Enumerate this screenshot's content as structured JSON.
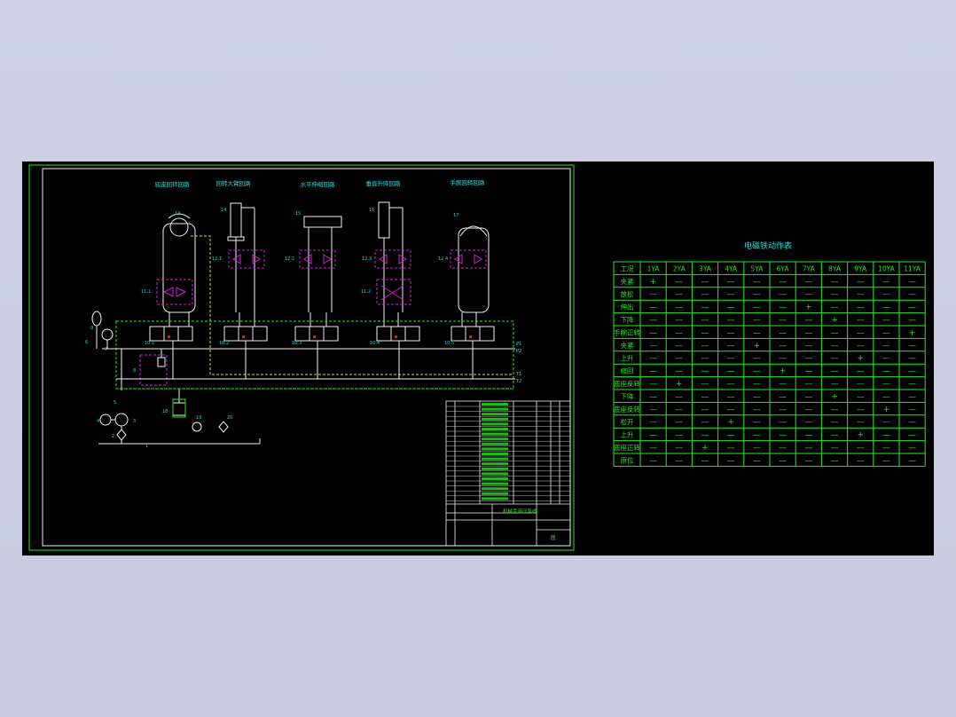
{
  "colors": {
    "background": "#000000",
    "viewport_surround": "#cfd0e6",
    "frame": "#27e81f",
    "lines": "#f0f0f0",
    "labels": "#18e0e0",
    "valves": "#d81fd8",
    "pilot": "#d8d820",
    "red_marks": "#e02020"
  },
  "schematic": {
    "titles": [
      "底座回转回路",
      "回转大臂回路",
      "水平伸缩回路",
      "垂直升降回路",
      "手腕回转回路"
    ],
    "component_numbers": {
      "c1": "13",
      "c2": "14",
      "c3": "15",
      "c4": "16",
      "c5": "17",
      "v1": "12.1",
      "v2": "12.2",
      "v3": "12.3",
      "v4": "12.4",
      "v11_1": "11.1",
      "v11_2": "11.2",
      "d1": "10.1",
      "d2": "10.2",
      "d3": "10.3",
      "d4": "10.4",
      "d5": "10.5",
      "n1": "1",
      "n2": "2",
      "n3": "3",
      "n4": "4",
      "n5": "5",
      "n6": "6",
      "n7": "7",
      "n8": "8",
      "n9": "9",
      "n18": "18",
      "n19": "19",
      "n20": "20"
    },
    "port_labels": {
      "p1": "P1",
      "p2": "P2",
      "t1": "T1",
      "t2": "T2"
    },
    "solenoids": [
      "1YA",
      "2YA",
      "3YA",
      "4YA",
      "5YA",
      "6YA",
      "7YA",
      "8YA",
      "9YA",
      "10YA",
      "11YA"
    ]
  },
  "solenoid_table": {
    "title": "电磁铁动作表",
    "header_corner": "工况",
    "columns": [
      "1YA",
      "2YA",
      "3YA",
      "4YA",
      "5YA",
      "6YA",
      "7YA",
      "8YA",
      "9YA",
      "10YA",
      "11YA"
    ],
    "rows": [
      {
        "label": "夹紧",
        "values": [
          "+",
          "—",
          "—",
          "—",
          "—",
          "—",
          "—",
          "—",
          "—",
          "—",
          "—"
        ]
      },
      {
        "label": "放松",
        "values": [
          "—",
          "—",
          "—",
          "—",
          "—",
          "—",
          "—",
          "—",
          "—",
          "—",
          "—"
        ]
      },
      {
        "label": "伸出",
        "values": [
          "—",
          "—",
          "—",
          "—",
          "—",
          "—",
          "+",
          "—",
          "—",
          "—",
          "—"
        ]
      },
      {
        "label": "下降",
        "values": [
          "—",
          "—",
          "—",
          "—",
          "—",
          "—",
          "—",
          "+",
          "—",
          "—",
          "—"
        ]
      },
      {
        "label": "手腕正转",
        "values": [
          "—",
          "—",
          "—",
          "—",
          "—",
          "—",
          "—",
          "—",
          "—",
          "—",
          "+"
        ]
      },
      {
        "label": "夹紧",
        "values": [
          "—",
          "—",
          "—",
          "—",
          "+",
          "—",
          "—",
          "—",
          "—",
          "—",
          "—"
        ]
      },
      {
        "label": "上升",
        "values": [
          "—",
          "—",
          "—",
          "—",
          "—",
          "—",
          "—",
          "—",
          "+",
          "—",
          "—"
        ]
      },
      {
        "label": "缩回",
        "values": [
          "—",
          "—",
          "—",
          "—",
          "—",
          "+",
          "—",
          "—",
          "—",
          "—",
          "—"
        ]
      },
      {
        "label": "底座反转",
        "values": [
          "—",
          "+",
          "—",
          "—",
          "—",
          "—",
          "—",
          "—",
          "—",
          "—",
          "—"
        ]
      },
      {
        "label": "下降",
        "values": [
          "—",
          "—",
          "—",
          "—",
          "—",
          "—",
          "—",
          "+",
          "—",
          "—",
          "—"
        ]
      },
      {
        "label": "底座反转",
        "values": [
          "—",
          "—",
          "—",
          "—",
          "—",
          "—",
          "—",
          "—",
          "—",
          "+",
          "—"
        ]
      },
      {
        "label": "松开",
        "values": [
          "—",
          "—",
          "—",
          "+",
          "—",
          "—",
          "—",
          "—",
          "—",
          "—",
          "—"
        ]
      },
      {
        "label": "上升",
        "values": [
          "—",
          "—",
          "—",
          "—",
          "—",
          "—",
          "—",
          "—",
          "+",
          "—",
          "—"
        ]
      },
      {
        "label": "底座正转",
        "values": [
          "—",
          "—",
          "+",
          "—",
          "—",
          "—",
          "—",
          "—",
          "—",
          "—",
          "—"
        ]
      },
      {
        "label": "原位",
        "values": [
          "—",
          "—",
          "—",
          "—",
          "—",
          "—",
          "—",
          "—",
          "—",
          "—",
          "—"
        ]
      }
    ]
  },
  "title_block": {
    "drawing_name": "机械手液压系统",
    "sheet": "图"
  }
}
